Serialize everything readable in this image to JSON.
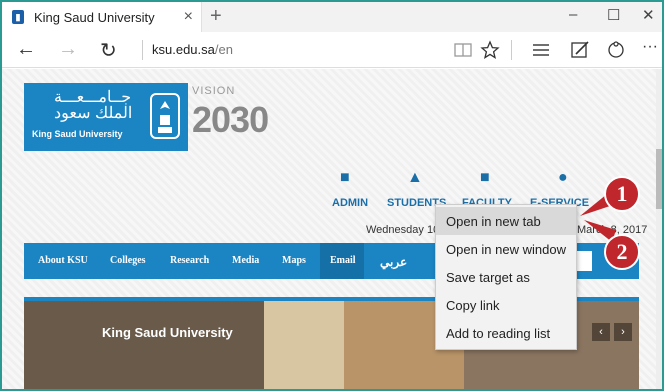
{
  "tab": {
    "title": "King Saud University",
    "close": "×",
    "new_tab": "+"
  },
  "window": {
    "minimize": "–",
    "maximize": "☐",
    "close": "✕"
  },
  "nav": {
    "back": "←",
    "forward": "→",
    "refresh": "↻",
    "url_host": "ksu.edu.sa",
    "url_path": "/en",
    "more": "···"
  },
  "logo": {
    "arabic_line1": "جــامـــعـــة",
    "arabic_line2": "الملك سعود",
    "english": "King Saud University"
  },
  "vision": {
    "label": "VISION",
    "year": "2030"
  },
  "top_menu": [
    "ADMIN",
    "STUDENTS",
    "FACULTY",
    "E-SERVICE"
  ],
  "date_left": "Wednesday 10",
  "date_right": "March 8, 2017",
  "main_nav": [
    "About KSU",
    "Colleges",
    "Research",
    "Media",
    "Maps",
    "Email",
    "عربي"
  ],
  "slider": {
    "title": "King Saud University",
    "prev": "‹",
    "next": "›"
  },
  "context_menu": {
    "items": [
      "Open in new tab",
      "Open in new window",
      "Save target as",
      "Copy link",
      "Add to reading list"
    ],
    "highlighted_index": 0
  },
  "callouts": [
    "1",
    "2"
  ],
  "colors": {
    "frame": "#2a9a93",
    "brand_blue": "#1b84c3",
    "callout_red": "#c0272d"
  }
}
